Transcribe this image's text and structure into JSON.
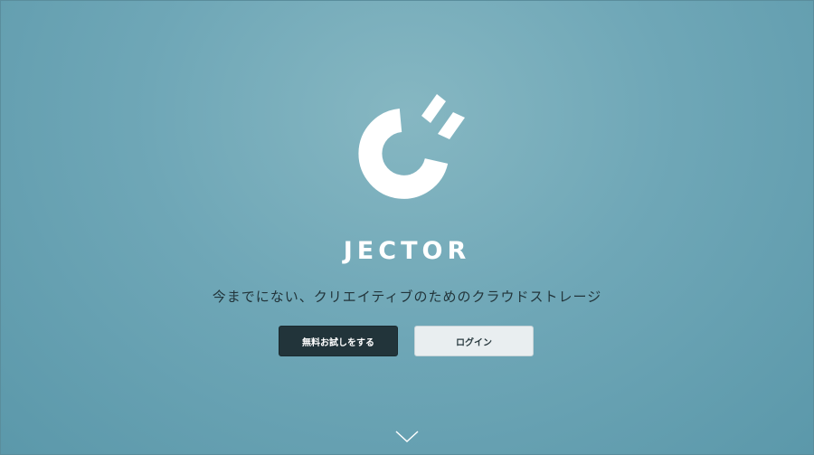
{
  "brand": {
    "name": "JECTOR",
    "logo_icon": "power-arc-logo-icon",
    "tagline": "今までにない、クリエイティブのためのクラウドストレージ"
  },
  "actions": {
    "trial_label": "無料お試しをする",
    "login_label": "ログイン"
  },
  "scroll": {
    "icon": "chevron-down-icon"
  },
  "colors": {
    "background": "#6fa7b7",
    "primary_button": "#22343a",
    "secondary_button": "#e9eef0",
    "logo": "#ffffff"
  }
}
